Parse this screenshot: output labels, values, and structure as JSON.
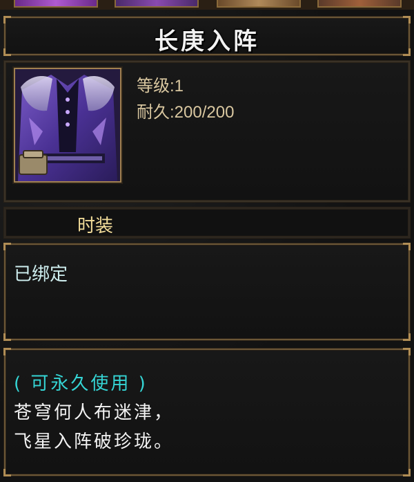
{
  "item": {
    "name": "长庚入阵",
    "icon": "purple-costume-icon"
  },
  "stats": {
    "level": "等级:1",
    "durability": "耐久:200/200"
  },
  "type": "时装",
  "bind_status": "已绑定",
  "description": {
    "usage": "( 可永久使用 )",
    "line1": "苍穹何人布迷津，",
    "line2": "飞星入阵破珍珑。"
  },
  "colors": {
    "title": "#f2f2f2",
    "stat": "#d9c7a0",
    "type_label": "#f3dd9a",
    "bind": "#cfeff0",
    "usage": "#35d5d5",
    "flavor": "#f3f3f3",
    "border": "#6b5636"
  }
}
